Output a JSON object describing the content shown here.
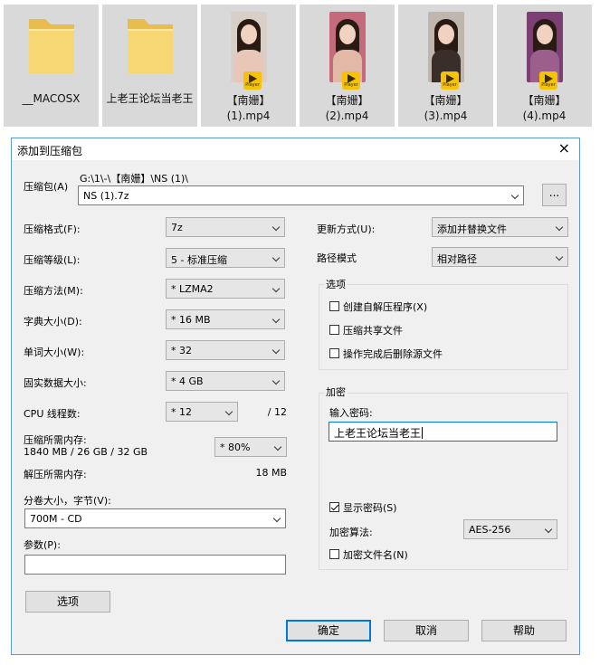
{
  "files": [
    {
      "name": "__MACOSX",
      "kind": "folder-icon"
    },
    {
      "name": "上老王论坛当老王",
      "kind": "folder-icon"
    },
    {
      "name": "【南姗】(1).mp4",
      "line1": "【南姗】",
      "line2": "(1).mp4",
      "kind": "video-thumbnail",
      "badge": "Player"
    },
    {
      "name": "【南姗】(2).mp4",
      "line1": "【南姗】",
      "line2": "(2).mp4",
      "kind": "video-thumbnail",
      "badge": "Player"
    },
    {
      "name": "【南姗】(3).mp4",
      "line1": "【南姗】",
      "line2": "(3).mp4",
      "kind": "video-thumbnail",
      "badge": "Player"
    },
    {
      "name": "【南姗】(4).mp4",
      "line1": "【南姗】",
      "line2": "(4).mp4",
      "kind": "video-thumbnail",
      "badge": "Player"
    }
  ],
  "dialog": {
    "title": "添加到压缩包",
    "close_icon": "×",
    "archive": {
      "label": "压缩包(A)",
      "path": "G:\\1\\-\\【南姗】\\NS (1)\\",
      "filename": "NS (1).7z",
      "browse_label": "..."
    },
    "left": {
      "format": {
        "label": "压缩格式(F):",
        "value": "7z"
      },
      "level": {
        "label": "压缩等级(L):",
        "value": "5 - 标准压缩"
      },
      "method": {
        "label": "压缩方法(M):",
        "value": "*  LZMA2"
      },
      "dict": {
        "label": "字典大小(D):",
        "value": "*  16 MB"
      },
      "word": {
        "label": "单词大小(W):",
        "value": "*  32"
      },
      "solid": {
        "label": "固实数据大小:",
        "value": "*  4 GB"
      },
      "threads": {
        "label": "CPU 线程数:",
        "value": "*  12",
        "max": "/ 12"
      },
      "mem_compress": {
        "label": "压缩所需内存:",
        "detail": "1840 MB / 26 GB / 32 GB",
        "value": "*  80%"
      },
      "mem_decompress": {
        "label": "解压所需内存:",
        "value": "18 MB"
      },
      "volume": {
        "label": "分卷大小，字节(V):",
        "value": "700M - CD"
      },
      "params": {
        "label": "参数(P):",
        "value": ""
      },
      "options_button": "选项"
    },
    "right": {
      "update": {
        "label": "更新方式(U):",
        "value": "添加并替换文件"
      },
      "path_mode": {
        "label": "路径模式",
        "value": "相对路径"
      },
      "options": {
        "title": "选项",
        "sfx": {
          "label": "创建自解压程序(X)",
          "checked": false
        },
        "shared": {
          "label": "压缩共享文件",
          "checked": false
        },
        "delete_after": {
          "label": "操作完成后删除源文件",
          "checked": false
        }
      },
      "encryption": {
        "title": "加密",
        "password_label": "输入密码:",
        "password_value": "上老王论坛当老王",
        "show_password": {
          "label": "显示密码(S)",
          "checked": true
        },
        "method_label": "加密算法:",
        "method_value": "AES-256",
        "encrypt_names": {
          "label": "加密文件名(N)",
          "checked": false
        }
      }
    },
    "buttons": {
      "ok": "确定",
      "cancel": "取消",
      "help": "帮助"
    }
  },
  "colors": {
    "accent": "#0078d7",
    "dialog_bg": "#f0f0f0",
    "folder": "#f7d774",
    "badge": "#f6c300"
  }
}
